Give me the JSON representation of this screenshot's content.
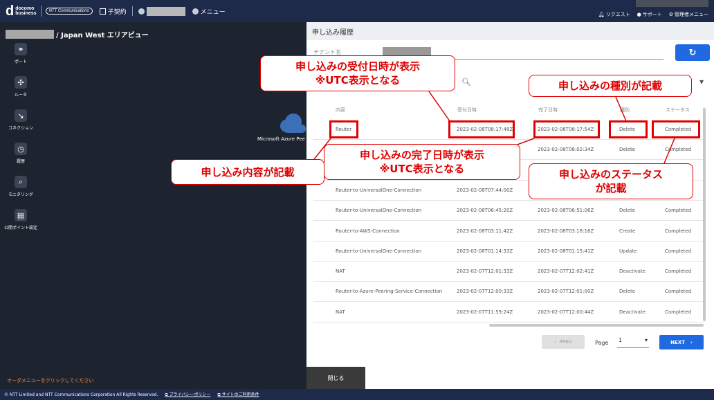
{
  "header": {
    "logo_mark": "d",
    "logo_line1": "docomo",
    "logo_line2": "business",
    "ntt": "NTT Communications",
    "contract": "子契約",
    "menu": "メニュー",
    "request": "リクエスト",
    "support": "サポート",
    "admin": "管理者メニュー"
  },
  "region_title": "/ Japan West エリアビュー",
  "nav": [
    {
      "icon": "port-icon",
      "label": "ポート"
    },
    {
      "icon": "router-icon",
      "label": "ルータ"
    },
    {
      "icon": "connection-icon",
      "label": "コネクション"
    },
    {
      "icon": "history-icon",
      "label": "履歴"
    },
    {
      "icon": "monitoring-icon",
      "label": "モニタリング"
    },
    {
      "icon": "public-point-icon",
      "label": "公開ポイント設定"
    }
  ],
  "canvas": {
    "cloud_label": "Microsoft Azure Pee"
  },
  "order_hint": "オーダメニューをクリックしてください",
  "panel": {
    "title": "申し込み履歴",
    "tenant_label": "テナント名",
    "columns": [
      "内容",
      "受付日時",
      "完了日時",
      "種別",
      "ステータス"
    ],
    "rows": [
      [
        "Router",
        "2023-02-08T08:17:48Z",
        "2023-02-08T08:17:54Z",
        "Delete",
        "Completed"
      ],
      [
        "",
        "",
        "2023-02-08T08:02:34Z",
        "Delete",
        "Completed"
      ],
      [
        "",
        "",
        "",
        "",
        ""
      ],
      [
        "Router-to-UniversalOne-Connection",
        "2023-02-08T07:44:00Z",
        "",
        "",
        ""
      ],
      [
        "Router-to-UniversalOne-Connection",
        "2023-02-08T06:45:20Z",
        "2023-02-08T06:51:06Z",
        "Delete",
        "Completed"
      ],
      [
        "Router-to-AWS-Connection",
        "2023-02-08T03:11:42Z",
        "2023-02-08T03:18:16Z",
        "Create",
        "Completed"
      ],
      [
        "Router-to-UniversalOne-Connection",
        "2023-02-08T01:14:33Z",
        "2023-02-08T01:15:41Z",
        "Update",
        "Completed"
      ],
      [
        "NAT",
        "2023-02-07T12:01:33Z",
        "2023-02-07T12:02:41Z",
        "Deactivate",
        "Completed"
      ],
      [
        "Router-to-Azure-Peering-Service-Connection",
        "2023-02-07T12:00:33Z",
        "2023-02-07T12:01:00Z",
        "Delete",
        "Completed"
      ],
      [
        "NAT",
        "2023-02-07T11:59:24Z",
        "2023-02-07T12:00:44Z",
        "Deactivate",
        "Completed"
      ]
    ],
    "prev": "PREV",
    "page_label": "Page",
    "page_value": "1",
    "next": "NEXT",
    "close": "閉じる"
  },
  "footer": {
    "copyright": "© NTT Limited and NTT Communications Corporation All Rights Reserved.",
    "privacy": "プライバシーポリシー",
    "terms": "サイトのご利用条件"
  },
  "annotations": {
    "received": [
      "申し込みの受付日時が表示",
      "※UTC表示となる"
    ],
    "kind": "申し込みの種別が記載",
    "completed": [
      "申し込みの完了日時が表示",
      "※UTC表示となる"
    ],
    "content": "申し込み内容が記載",
    "status": [
      "申し込みのステータス",
      "が記載"
    ]
  },
  "colors": {
    "accent": "#1f6ae0",
    "annotation": "#e00000",
    "header": "#1e2a4a"
  }
}
